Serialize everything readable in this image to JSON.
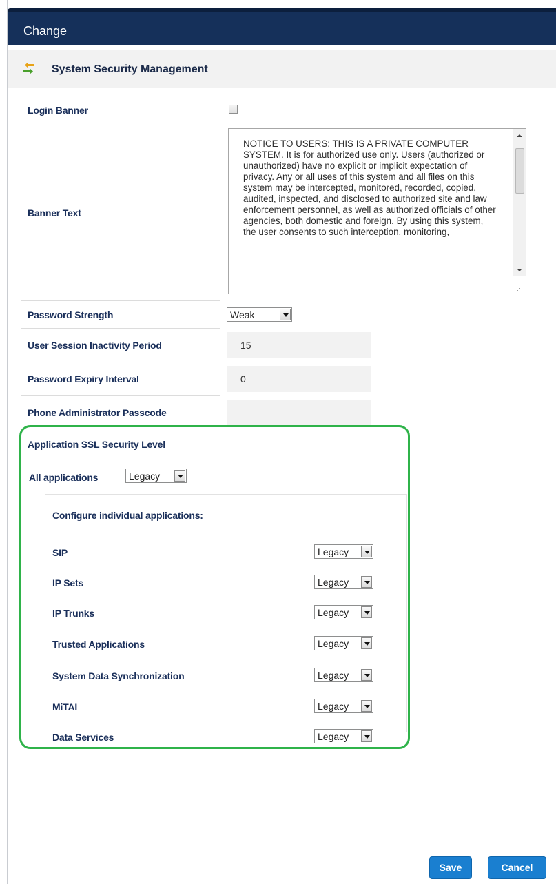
{
  "dialog": {
    "title": "Change"
  },
  "section": {
    "title": "System Security Management",
    "icon": "arrows-icon"
  },
  "login_banner": {
    "label": "Login Banner",
    "checked": false
  },
  "banner_text": {
    "label": "Banner Text",
    "value": "NOTICE TO USERS: THIS IS A PRIVATE COMPUTER SYSTEM. It is for authorized use only. Users (authorized or unauthorized) have no explicit or implicit expectation of privacy. Any or all uses of this system and all files on this system may be intercepted, monitored, recorded, copied, audited, inspected, and disclosed to authorized site and law enforcement personnel, as well as authorized officials of other agencies, both domestic and foreign. By using this system, the user consents to such interception, monitoring,"
  },
  "password_strength": {
    "label": "Password Strength",
    "value": "Weak"
  },
  "session_inactivity": {
    "label": "User Session Inactivity Period",
    "value": "15"
  },
  "password_expiry": {
    "label": "Password Expiry Interval",
    "value": "0"
  },
  "phone_admin_passcode": {
    "label": "Phone Administrator Passcode",
    "value": ""
  },
  "ssl": {
    "label": "Application SSL Security Level",
    "all_label": "All applications",
    "all_value": "Legacy",
    "configure_label": "Configure individual applications:",
    "apps": [
      {
        "label": "SIP",
        "value": "Legacy"
      },
      {
        "label": "IP Sets",
        "value": "Legacy"
      },
      {
        "label": "IP Trunks",
        "value": "Legacy"
      },
      {
        "label": "Trusted Applications",
        "value": "Legacy"
      },
      {
        "label": "System Data Synchronization",
        "value": "Legacy"
      },
      {
        "label": "MiTAI",
        "value": "Legacy"
      },
      {
        "label": "Data Services",
        "value": "Legacy"
      }
    ]
  },
  "buttons": {
    "save": "Save",
    "cancel": "Cancel"
  },
  "colors": {
    "title_bar": "#15305a",
    "primary_button": "#1a7fd0",
    "highlight_outline": "#2fb34a"
  }
}
